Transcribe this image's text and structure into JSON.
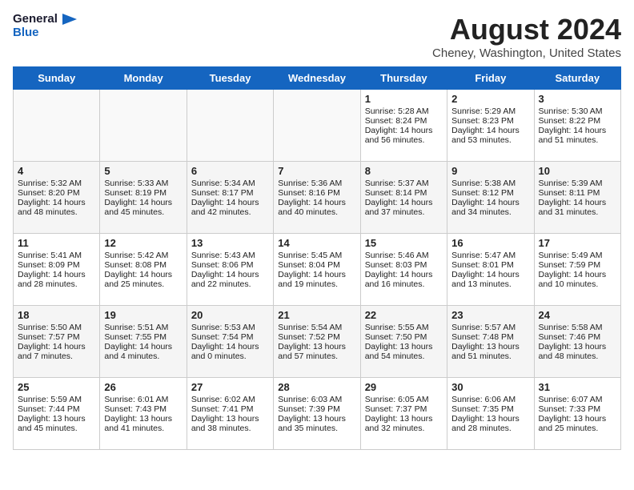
{
  "header": {
    "logo_line1": "General",
    "logo_line2": "Blue",
    "month": "August 2024",
    "location": "Cheney, Washington, United States"
  },
  "weekdays": [
    "Sunday",
    "Monday",
    "Tuesday",
    "Wednesday",
    "Thursday",
    "Friday",
    "Saturday"
  ],
  "weeks": [
    [
      {
        "num": "",
        "text": ""
      },
      {
        "num": "",
        "text": ""
      },
      {
        "num": "",
        "text": ""
      },
      {
        "num": "",
        "text": ""
      },
      {
        "num": "1",
        "text": "Sunrise: 5:28 AM\nSunset: 8:24 PM\nDaylight: 14 hours\nand 56 minutes."
      },
      {
        "num": "2",
        "text": "Sunrise: 5:29 AM\nSunset: 8:23 PM\nDaylight: 14 hours\nand 53 minutes."
      },
      {
        "num": "3",
        "text": "Sunrise: 5:30 AM\nSunset: 8:22 PM\nDaylight: 14 hours\nand 51 minutes."
      }
    ],
    [
      {
        "num": "4",
        "text": "Sunrise: 5:32 AM\nSunset: 8:20 PM\nDaylight: 14 hours\nand 48 minutes."
      },
      {
        "num": "5",
        "text": "Sunrise: 5:33 AM\nSunset: 8:19 PM\nDaylight: 14 hours\nand 45 minutes."
      },
      {
        "num": "6",
        "text": "Sunrise: 5:34 AM\nSunset: 8:17 PM\nDaylight: 14 hours\nand 42 minutes."
      },
      {
        "num": "7",
        "text": "Sunrise: 5:36 AM\nSunset: 8:16 PM\nDaylight: 14 hours\nand 40 minutes."
      },
      {
        "num": "8",
        "text": "Sunrise: 5:37 AM\nSunset: 8:14 PM\nDaylight: 14 hours\nand 37 minutes."
      },
      {
        "num": "9",
        "text": "Sunrise: 5:38 AM\nSunset: 8:12 PM\nDaylight: 14 hours\nand 34 minutes."
      },
      {
        "num": "10",
        "text": "Sunrise: 5:39 AM\nSunset: 8:11 PM\nDaylight: 14 hours\nand 31 minutes."
      }
    ],
    [
      {
        "num": "11",
        "text": "Sunrise: 5:41 AM\nSunset: 8:09 PM\nDaylight: 14 hours\nand 28 minutes."
      },
      {
        "num": "12",
        "text": "Sunrise: 5:42 AM\nSunset: 8:08 PM\nDaylight: 14 hours\nand 25 minutes."
      },
      {
        "num": "13",
        "text": "Sunrise: 5:43 AM\nSunset: 8:06 PM\nDaylight: 14 hours\nand 22 minutes."
      },
      {
        "num": "14",
        "text": "Sunrise: 5:45 AM\nSunset: 8:04 PM\nDaylight: 14 hours\nand 19 minutes."
      },
      {
        "num": "15",
        "text": "Sunrise: 5:46 AM\nSunset: 8:03 PM\nDaylight: 14 hours\nand 16 minutes."
      },
      {
        "num": "16",
        "text": "Sunrise: 5:47 AM\nSunset: 8:01 PM\nDaylight: 14 hours\nand 13 minutes."
      },
      {
        "num": "17",
        "text": "Sunrise: 5:49 AM\nSunset: 7:59 PM\nDaylight: 14 hours\nand 10 minutes."
      }
    ],
    [
      {
        "num": "18",
        "text": "Sunrise: 5:50 AM\nSunset: 7:57 PM\nDaylight: 14 hours\nand 7 minutes."
      },
      {
        "num": "19",
        "text": "Sunrise: 5:51 AM\nSunset: 7:55 PM\nDaylight: 14 hours\nand 4 minutes."
      },
      {
        "num": "20",
        "text": "Sunrise: 5:53 AM\nSunset: 7:54 PM\nDaylight: 14 hours and 0 minutes."
      },
      {
        "num": "21",
        "text": "Sunrise: 5:54 AM\nSunset: 7:52 PM\nDaylight: 13 hours\nand 57 minutes."
      },
      {
        "num": "22",
        "text": "Sunrise: 5:55 AM\nSunset: 7:50 PM\nDaylight: 13 hours\nand 54 minutes."
      },
      {
        "num": "23",
        "text": "Sunrise: 5:57 AM\nSunset: 7:48 PM\nDaylight: 13 hours\nand 51 minutes."
      },
      {
        "num": "24",
        "text": "Sunrise: 5:58 AM\nSunset: 7:46 PM\nDaylight: 13 hours\nand 48 minutes."
      }
    ],
    [
      {
        "num": "25",
        "text": "Sunrise: 5:59 AM\nSunset: 7:44 PM\nDaylight: 13 hours\nand 45 minutes."
      },
      {
        "num": "26",
        "text": "Sunrise: 6:01 AM\nSunset: 7:43 PM\nDaylight: 13 hours\nand 41 minutes."
      },
      {
        "num": "27",
        "text": "Sunrise: 6:02 AM\nSunset: 7:41 PM\nDaylight: 13 hours\nand 38 minutes."
      },
      {
        "num": "28",
        "text": "Sunrise: 6:03 AM\nSunset: 7:39 PM\nDaylight: 13 hours\nand 35 minutes."
      },
      {
        "num": "29",
        "text": "Sunrise: 6:05 AM\nSunset: 7:37 PM\nDaylight: 13 hours\nand 32 minutes."
      },
      {
        "num": "30",
        "text": "Sunrise: 6:06 AM\nSunset: 7:35 PM\nDaylight: 13 hours\nand 28 minutes."
      },
      {
        "num": "31",
        "text": "Sunrise: 6:07 AM\nSunset: 7:33 PM\nDaylight: 13 hours\nand 25 minutes."
      }
    ]
  ]
}
